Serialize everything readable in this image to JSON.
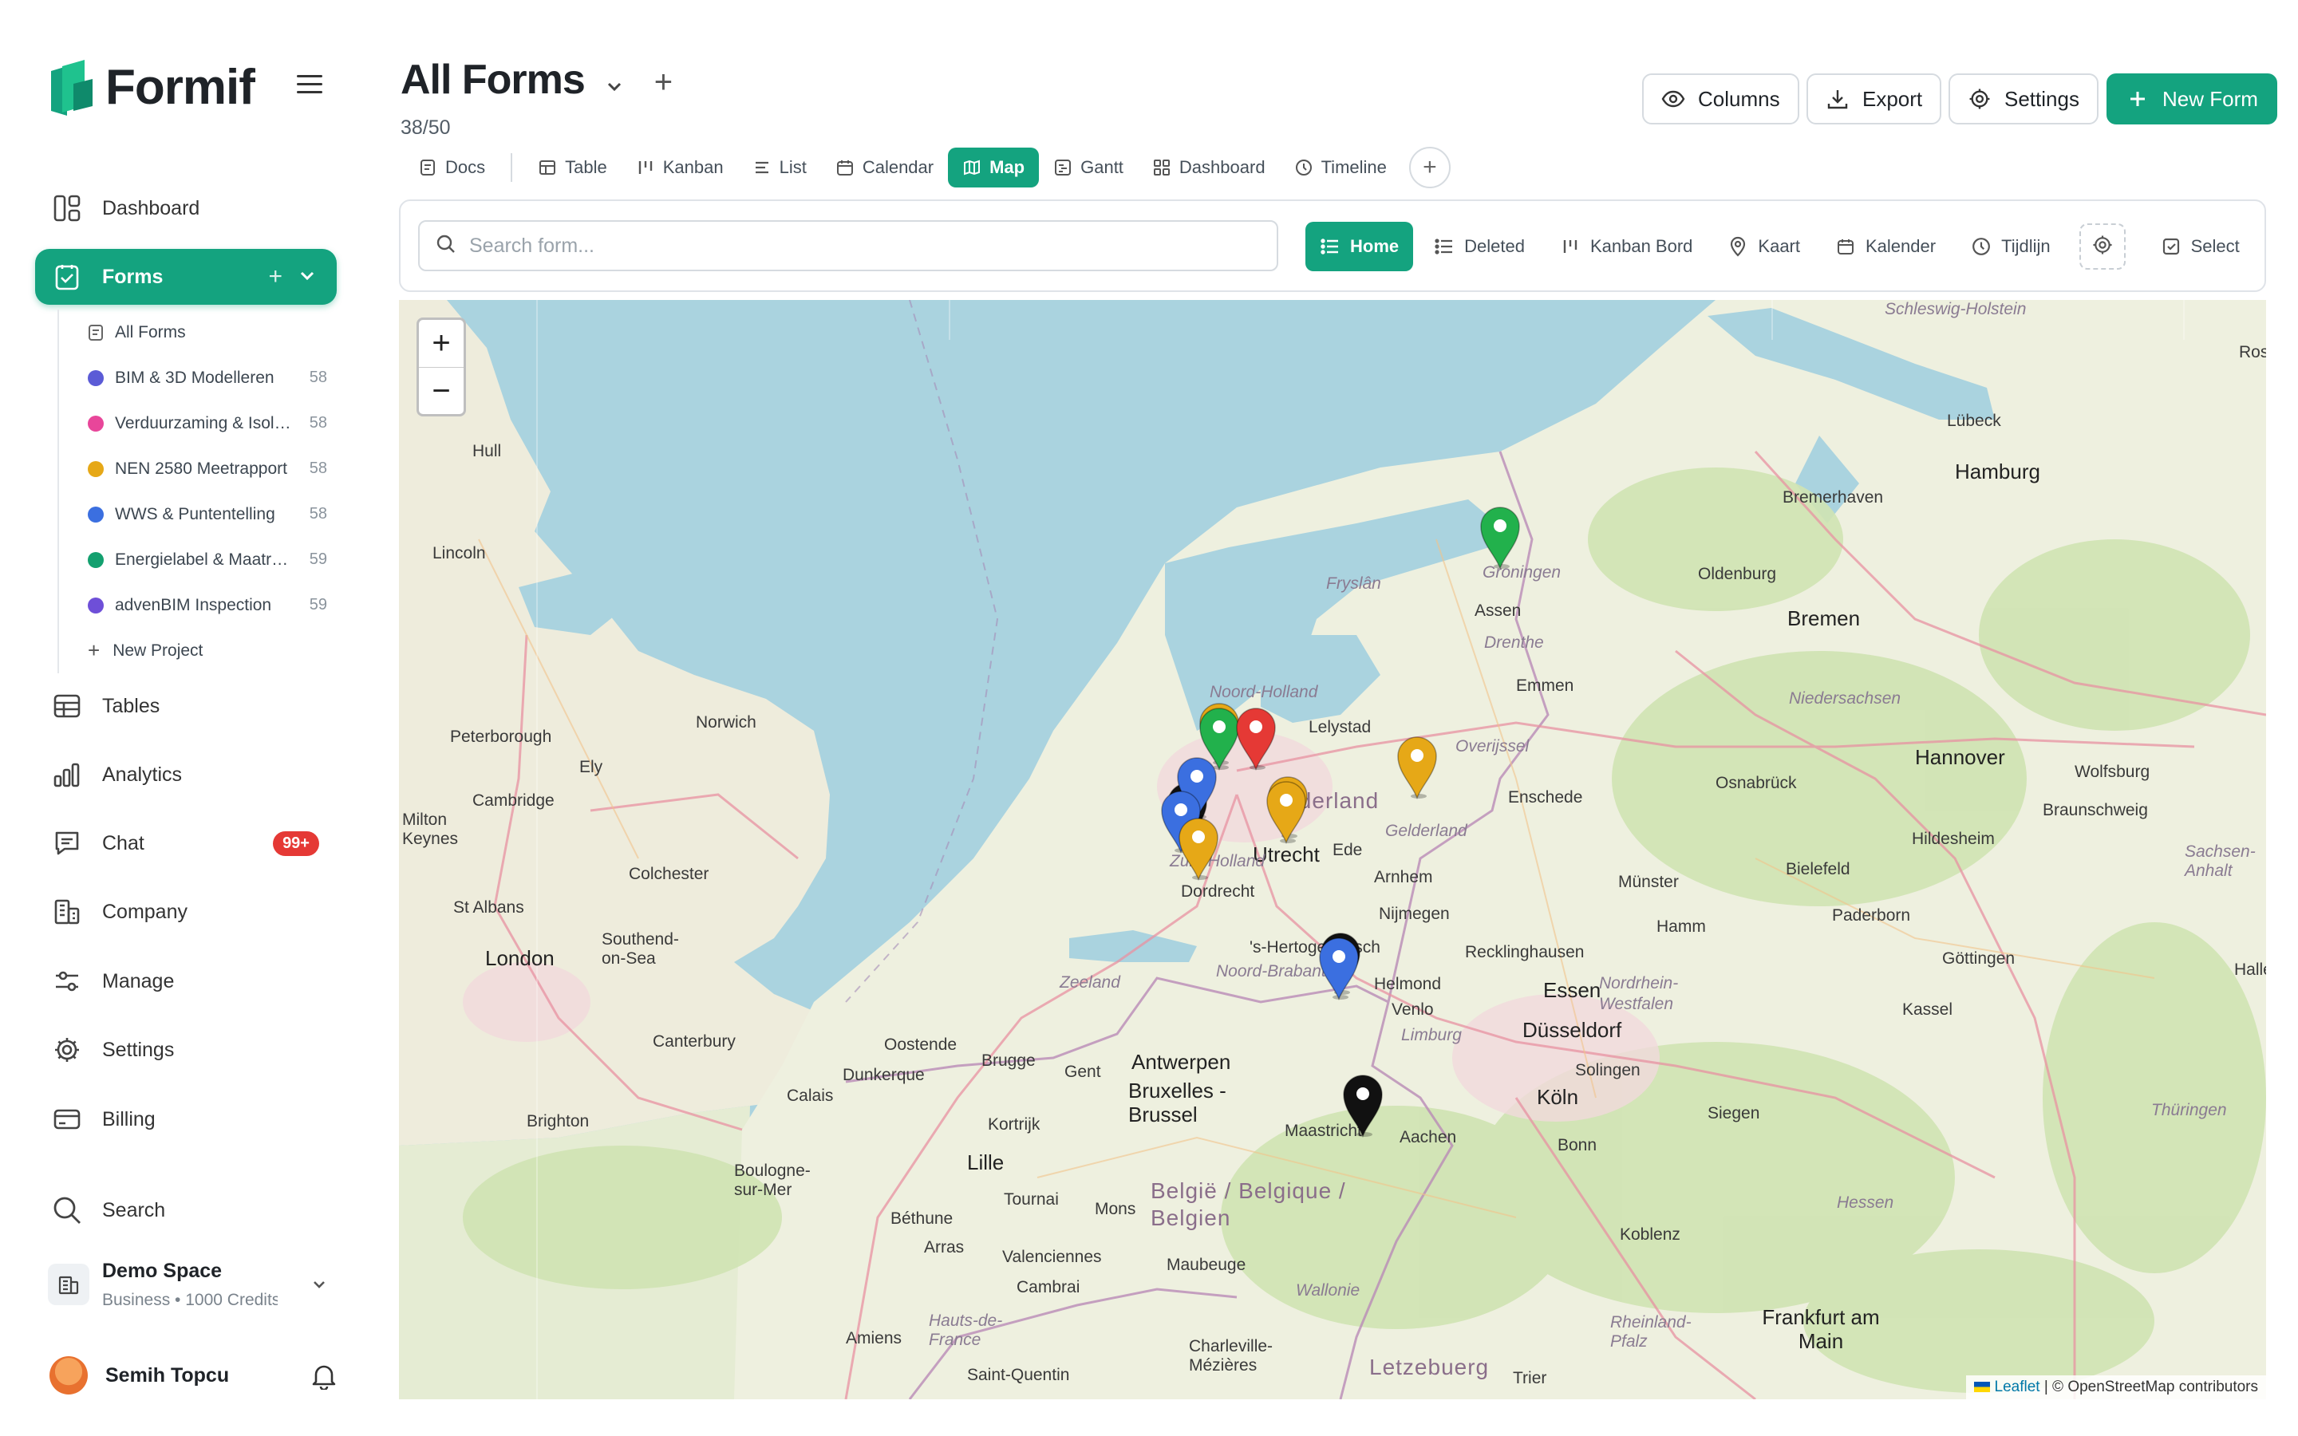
{
  "app": {
    "name": "Formif"
  },
  "sidebar": {
    "nav": [
      {
        "label": "Dashboard",
        "icon": "dashboard-icon"
      },
      {
        "label": "Forms",
        "icon": "forms-icon"
      },
      {
        "label": "Tables",
        "icon": "table-icon"
      },
      {
        "label": "Analytics",
        "icon": "analytics-icon"
      },
      {
        "label": "Chat",
        "icon": "chat-icon",
        "badge": "99+"
      },
      {
        "label": "Company",
        "icon": "company-icon"
      },
      {
        "label": "Manage",
        "icon": "sliders-icon"
      },
      {
        "label": "Settings",
        "icon": "gear-icon"
      },
      {
        "label": "Billing",
        "icon": "card-icon"
      },
      {
        "label": "Search",
        "icon": "search-icon"
      }
    ],
    "forms_sub": [
      {
        "label": "All Forms"
      },
      {
        "label": "BIM & 3D Modelleren",
        "count": "58",
        "color": "#5b5bd6"
      },
      {
        "label": "Verduurzaming & Isolatie",
        "count": "58",
        "color": "#e8469a"
      },
      {
        "label": "NEN 2580 Meetrapport",
        "count": "58",
        "color": "#e6a817"
      },
      {
        "label": "WWS & Puntentelling",
        "count": "58",
        "color": "#3b6fe0"
      },
      {
        "label": "Energielabel & Maatregelen",
        "count": "59",
        "color": "#13a06f"
      },
      {
        "label": "advenBIM Inspection",
        "count": "59",
        "color": "#6e4fd8"
      },
      {
        "label": "New Project"
      }
    ],
    "space": {
      "name": "Demo Space",
      "plan": "Business • 1000 Credits"
    },
    "user": {
      "name": "Semih Topcu"
    }
  },
  "header": {
    "title": "All Forms",
    "count": "38/50",
    "buttons": {
      "columns": "Columns",
      "export": "Export",
      "settings": "Settings",
      "new_form": "New Form"
    }
  },
  "views": [
    "Docs",
    "Table",
    "Kanban",
    "List",
    "Calendar",
    "Map",
    "Gantt",
    "Dashboard",
    "Timeline"
  ],
  "active_view": "Map",
  "toolbar": {
    "search_placeholder": "Search form...",
    "filters": [
      "Home",
      "Deleted",
      "Kanban Bord",
      "Kaart",
      "Kalender",
      "Tijdlijn"
    ],
    "select": "Select"
  },
  "map": {
    "zoom_in": "+",
    "zoom_out": "−",
    "attribution_leaflet": "Leaflet",
    "attribution_rest": "| © OpenStreetMap contributors",
    "places": [
      "Schleswig-Holstein",
      "Lübeck",
      "Hamburg",
      "Bremerhaven",
      "Oldenburg",
      "Bremen",
      "Groningen",
      "Assen",
      "Drenthe",
      "Fryslân",
      "Emmen",
      "Hull",
      "Lincoln",
      "Peterborough",
      "Norwich",
      "Ely",
      "Cambridge",
      "Milton Keynes",
      "Colchester",
      "St Albans",
      "London",
      "Southend-on-Sea",
      "Canterbury",
      "Brighton",
      "Dunkerque",
      "Calais",
      "Oostende",
      "Brugge",
      "Gent",
      "Antwerpen",
      "Bruxelles - Brussel",
      "Kortrijk",
      "Lille",
      "Boulogne-sur-Mer",
      "Béthune",
      "Arras",
      "Tournai",
      "Mons",
      "Valenciennes",
      "Maubeuge",
      "Cambrai",
      "Amiens",
      "Hauts-de-France",
      "Saint-Quentin",
      "Charleville-Mézières",
      "België / Belgique / Belgien",
      "Wallonie",
      "Letzebuerg",
      "Trier",
      "Noord-Holland",
      "Lelystad",
      "Nederland",
      "Utrecht",
      "Zuid-Holland",
      "Dordrecht",
      "Ede",
      "Arnhem",
      "Gelderland",
      "Overijssel",
      "Enschede",
      "Nijmegen",
      "'s-Hertogenbosch",
      "Noord-Brabant",
      "Zeeland",
      "Helmond",
      "Venlo",
      "Limburg",
      "Maastricht",
      "Aachen",
      "Essen",
      "Düsseldorf",
      "Recklinghausen",
      "Nordrhein-Westfalen",
      "Solingen",
      "Köln",
      "Bonn",
      "Siegen",
      "Koblenz",
      "Hessen",
      "Frankfurt am Main",
      "Rheinland-Pfalz",
      "Niedersachsen",
      "Hannover",
      "Wolfsburg",
      "Braunschweig",
      "Hildesheim",
      "Sachsen-Anhalt",
      "Osnabrück",
      "Münster",
      "Bielefeld",
      "Hamm",
      "Paderborn",
      "Göttingen",
      "Kassel",
      "Thüringen",
      "Halle",
      "Rostock"
    ],
    "pins": [
      {
        "color": "#22b14c",
        "label": "green"
      },
      {
        "color": "#e53935",
        "label": "red"
      },
      {
        "color": "#e6a817",
        "label": "yellow"
      },
      {
        "color": "#3b6fe0",
        "label": "blue"
      },
      {
        "color": "#111111",
        "label": "black"
      }
    ]
  }
}
